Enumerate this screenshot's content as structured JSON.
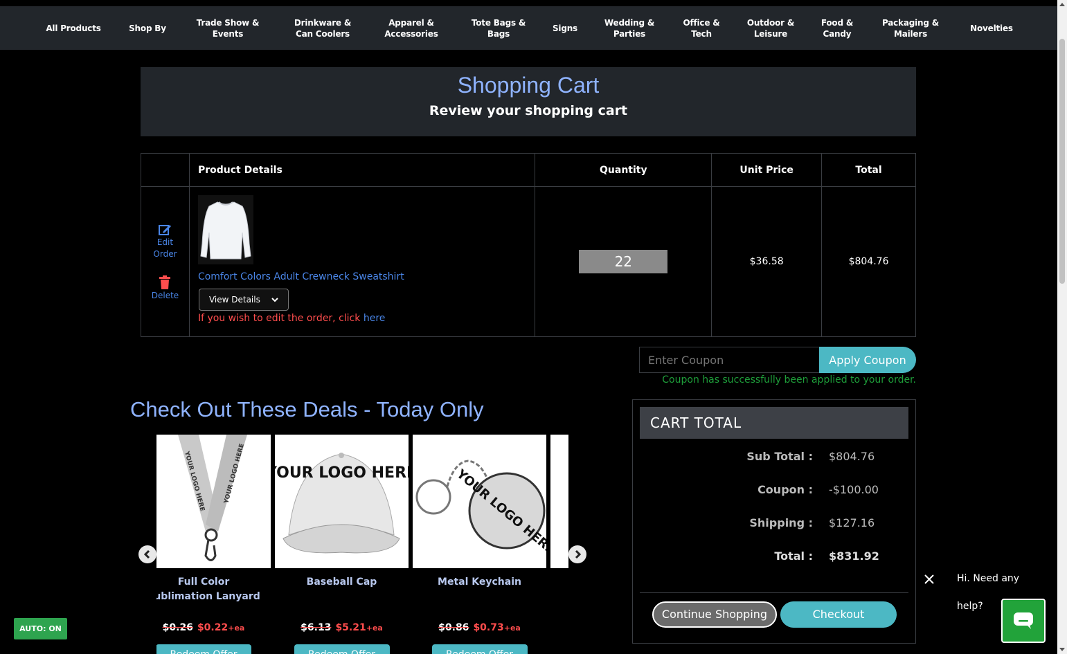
{
  "nav": {
    "items": [
      {
        "label": "All Products"
      },
      {
        "label": "Shop By"
      },
      {
        "label": "Trade Show &\nEvents"
      },
      {
        "label": "Drinkware &\nCan Coolers"
      },
      {
        "label": "Apparel &\nAccessories"
      },
      {
        "label": "Tote Bags &\nBags"
      },
      {
        "label": "Signs"
      },
      {
        "label": "Wedding &\nParties"
      },
      {
        "label": "Office &\nTech"
      },
      {
        "label": "Outdoor &\nLeisure"
      },
      {
        "label": "Food &\nCandy"
      },
      {
        "label": "Packaging &\nMailers"
      },
      {
        "label": "Novelties"
      }
    ]
  },
  "header": {
    "title": "Shopping Cart",
    "subtitle": "Review your shopping cart"
  },
  "table": {
    "col_product": "Product Details",
    "col_quantity": "Quantity",
    "col_unit_price": "Unit Price",
    "col_total": "Total",
    "row": {
      "edit_label": "Edit\nOrder",
      "delete_label": "Delete",
      "product_name": "Comfort Colors Adult Crewneck Sweatshirt",
      "view_details": "View Details",
      "edit_note": "If you wish to edit the order, click",
      "edit_link": "here",
      "quantity": "22",
      "unit_price": "$36.58",
      "total": "$804.76"
    }
  },
  "coupon": {
    "placeholder": "Enter Coupon",
    "button": "Apply Coupon",
    "message": "Coupon has successfully been applied to your order."
  },
  "deals": {
    "title": "Check Out These Deals - Today Only",
    "items": [
      {
        "name": "Full Color\nSublimation Lanyard",
        "old_price": "$0.26",
        "new_price": "$0.22",
        "suffix": "+ea",
        "button": "Redeem Offer",
        "img_text": "YOUR LOGO HERE"
      },
      {
        "name": "Baseball Cap",
        "old_price": "$6.13",
        "new_price": "$5.21",
        "suffix": "+ea",
        "button": "Redeem Offer",
        "img_text": "YOUR LOGO HERE"
      },
      {
        "name": "Metal Keychain",
        "old_price": "$0.86",
        "new_price": "$0.73",
        "suffix": "+ea",
        "button": "Redeem Offer",
        "img_text": "YOUR LOGO HERE"
      }
    ]
  },
  "cart_total": {
    "title": "CART  TOTAL",
    "sub_total_label": "Sub Total :",
    "sub_total": "$804.76",
    "coupon_label": "Coupon :",
    "coupon": "-$100.00",
    "shipping_label": "Shipping :",
    "shipping": "$127.16",
    "total_label": "Total :",
    "total": "$831.92",
    "continue_button": "Continue Shopping",
    "checkout_button": "Checkout"
  },
  "auto_badge": "AUTO: ON",
  "chat": {
    "message": "Hi. Need any help?"
  },
  "colors": {
    "accent_blue": "#8fb3ff",
    "link_blue": "#4a86e8",
    "teal": "#4cb8c4",
    "red": "#ff4d4d",
    "green": "#22a33a"
  }
}
